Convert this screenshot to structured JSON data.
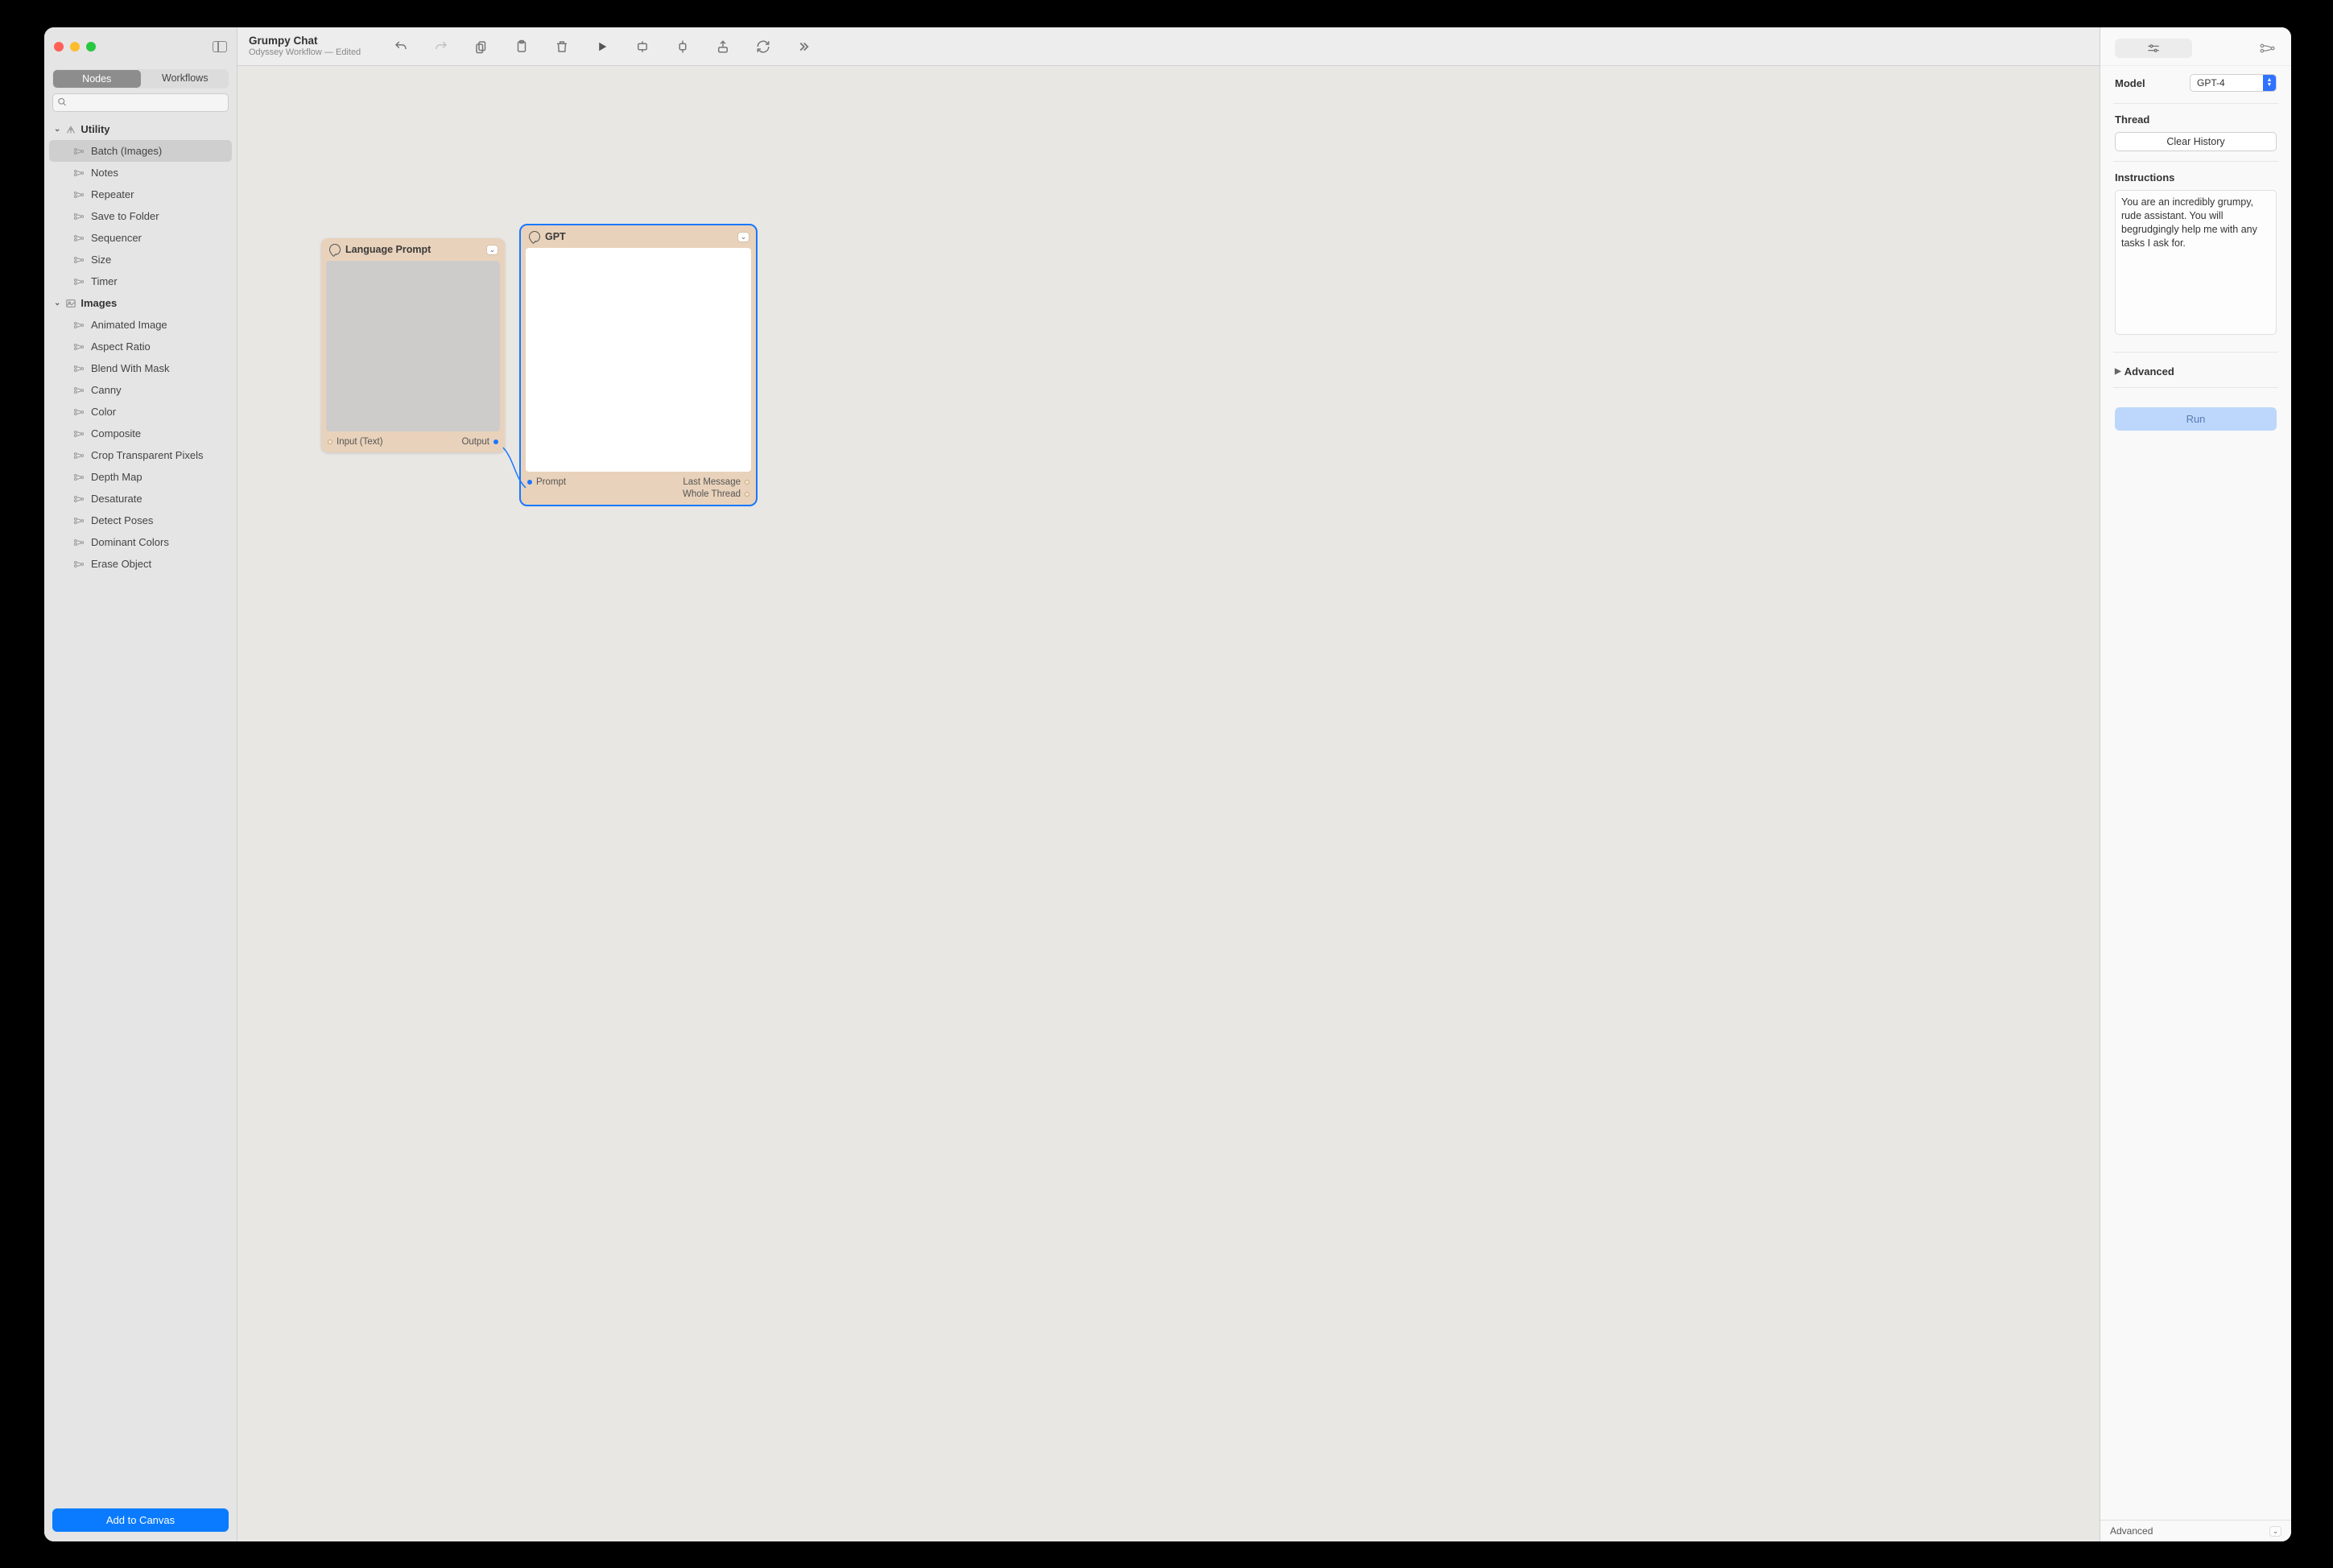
{
  "header": {
    "title": "Grumpy Chat",
    "subtitle": "Odyssey Workflow — Edited"
  },
  "sidebar": {
    "tabs": {
      "nodes": "Nodes",
      "workflows": "Workflows"
    },
    "search_placeholder": "",
    "add_button": "Add to Canvas",
    "groups": [
      {
        "title": "Utility",
        "items": [
          {
            "label": "Batch (Images)",
            "selected": true
          },
          {
            "label": "Notes"
          },
          {
            "label": "Repeater"
          },
          {
            "label": "Save to Folder"
          },
          {
            "label": "Sequencer"
          },
          {
            "label": "Size"
          },
          {
            "label": "Timer"
          }
        ]
      },
      {
        "title": "Images",
        "items": [
          {
            "label": "Animated Image"
          },
          {
            "label": "Aspect Ratio"
          },
          {
            "label": "Blend With Mask"
          },
          {
            "label": "Canny"
          },
          {
            "label": "Color"
          },
          {
            "label": "Composite"
          },
          {
            "label": "Crop Transparent Pixels"
          },
          {
            "label": "Depth Map"
          },
          {
            "label": "Desaturate"
          },
          {
            "label": "Detect Poses"
          },
          {
            "label": "Dominant Colors"
          },
          {
            "label": "Erase Object"
          }
        ]
      }
    ]
  },
  "canvas": {
    "nodes": [
      {
        "id": "lang",
        "title": "Language Prompt",
        "selected": false,
        "inputs": [
          {
            "label": "Input (Text)"
          }
        ],
        "outputs": [
          {
            "label": "Output"
          }
        ]
      },
      {
        "id": "gpt",
        "title": "GPT",
        "selected": true,
        "inputs": [
          {
            "label": "Prompt"
          }
        ],
        "outputs": [
          {
            "label": "Last Message"
          },
          {
            "label": "Whole Thread"
          }
        ]
      }
    ]
  },
  "inspector": {
    "model_label": "Model",
    "model_value": "GPT-4",
    "thread_label": "Thread",
    "clear_history": "Clear History",
    "instructions_label": "Instructions",
    "instructions_value": "You are an incredibly grumpy, rude assistant. You will begrudgingly help me with any tasks I ask for.",
    "advanced_label": "Advanced",
    "run_label": "Run",
    "footer_label": "Advanced"
  }
}
